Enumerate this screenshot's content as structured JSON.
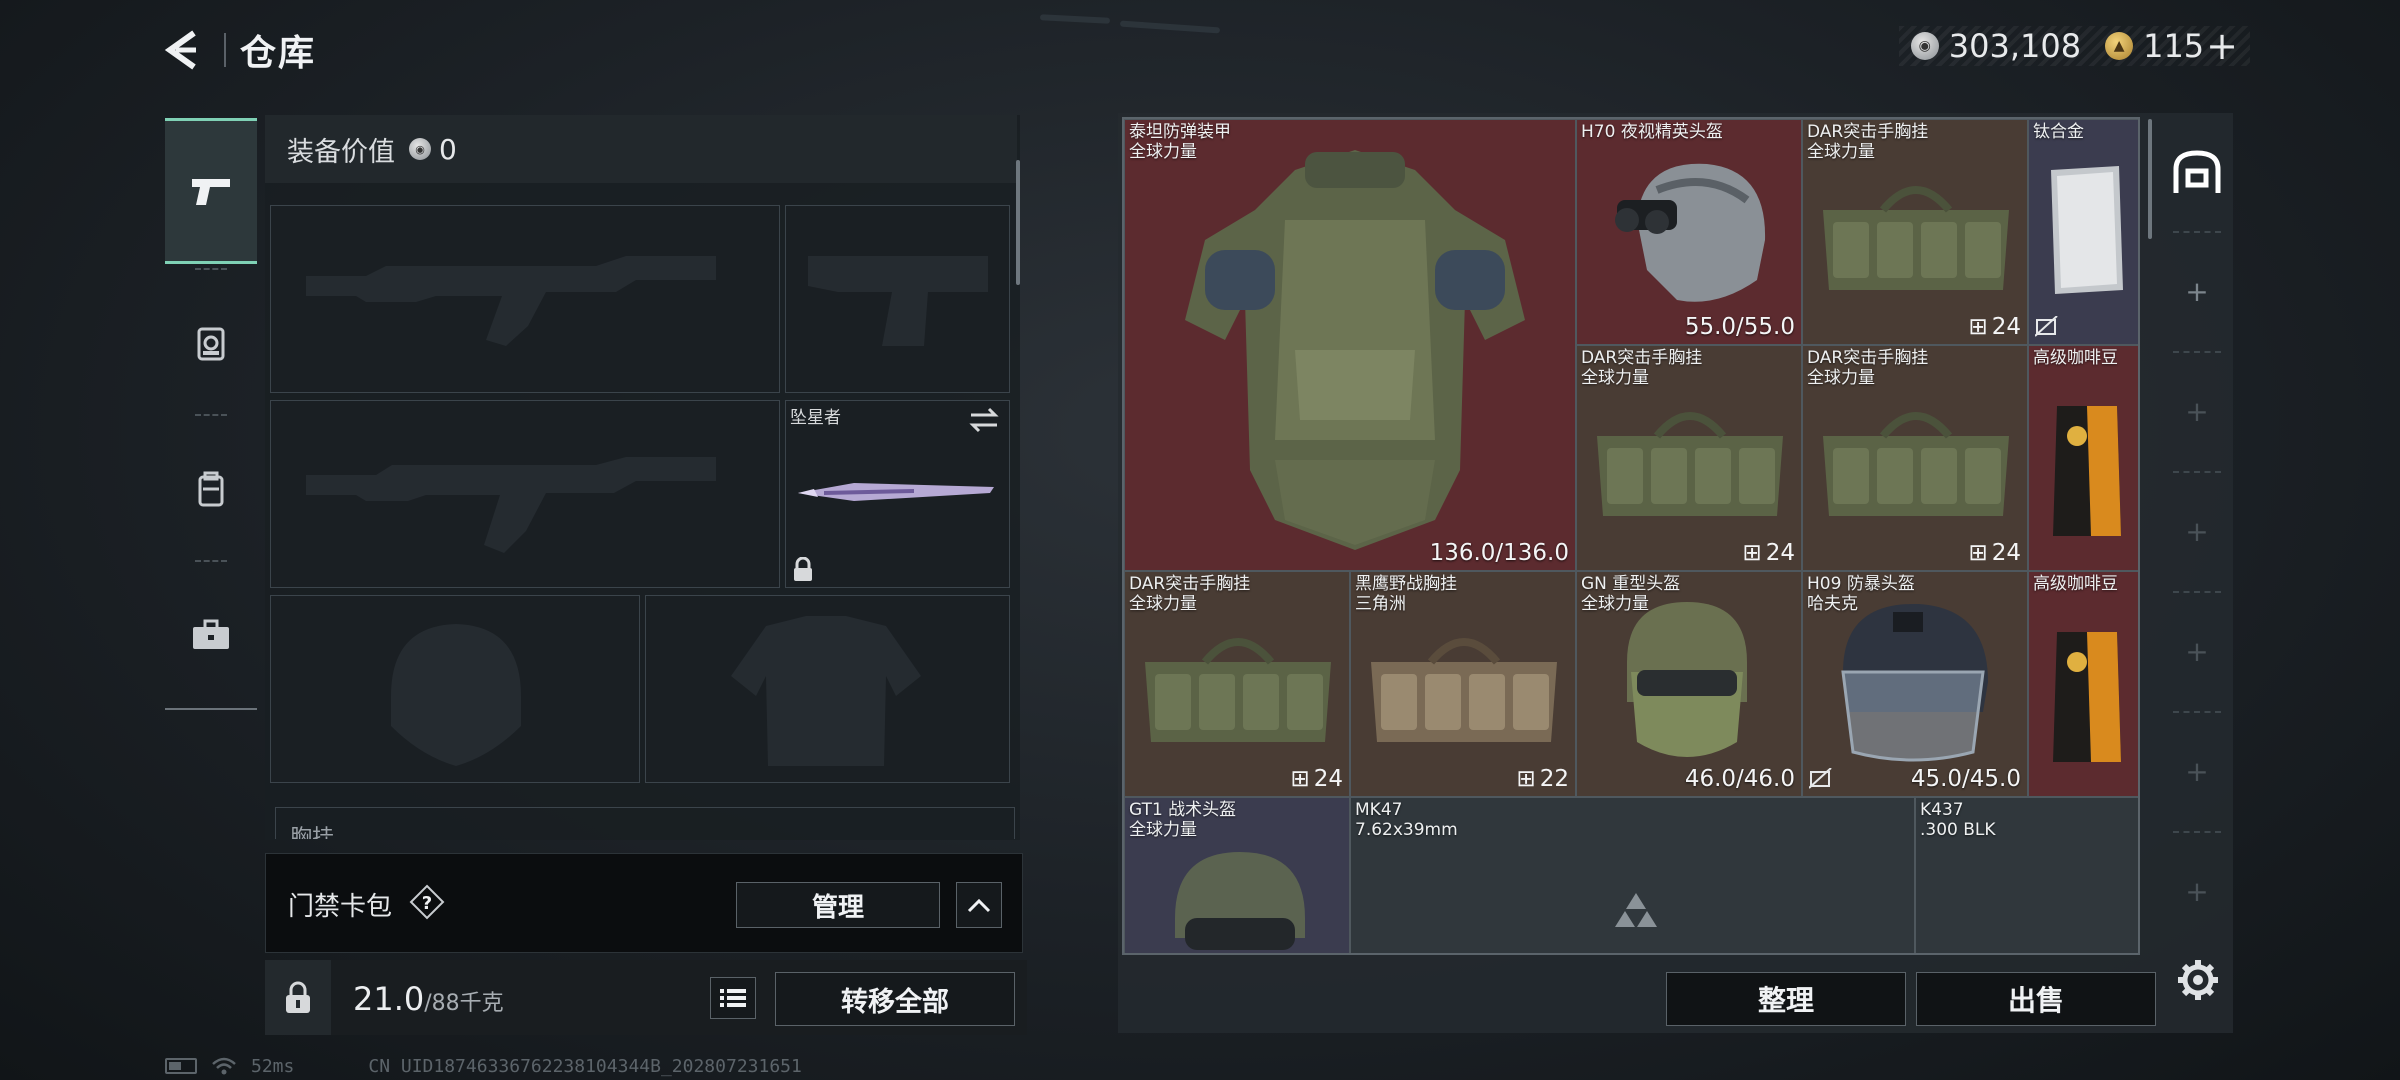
{
  "header": {
    "title": "仓库",
    "currency_silver": "303,108",
    "currency_gold": "115"
  },
  "equipment": {
    "value_label": "装备价值",
    "value": "0",
    "melee_name": "坠星者",
    "chest_label": "胸挂"
  },
  "card_pack": {
    "label": "门禁卡包",
    "manage_label": "管理"
  },
  "bag": {
    "weight": "21.0",
    "weight_max": "/88千克",
    "transfer_label": "转移全部"
  },
  "status_bar": {
    "ping": "52ms",
    "uid": "CN UID18746336762238104344B_202807231651"
  },
  "storage": {
    "items": [
      {
        "name": "泰坦防弹装甲",
        "sub": "全球力量",
        "value": "136.0/136.0"
      },
      {
        "name": "H70 夜视精英头盔",
        "sub": "",
        "value": "55.0/55.0"
      },
      {
        "name": "DAR突击手胸挂",
        "sub": "全球力量",
        "count": "24"
      },
      {
        "name": "钛合金",
        "sub": ""
      },
      {
        "name": "DAR突击手胸挂",
        "sub": "全球力量",
        "count": "24"
      },
      {
        "name": "DAR突击手胸挂",
        "sub": "全球力量",
        "count": "24"
      },
      {
        "name": "高级咖啡豆",
        "sub": ""
      },
      {
        "name": "DAR突击手胸挂",
        "sub": "全球力量",
        "count": "24"
      },
      {
        "name": "黑鹰野战胸挂",
        "sub": "三角洲",
        "count": "22"
      },
      {
        "name": "GN 重型头盔",
        "sub": "全球力量",
        "value": "46.0/46.0"
      },
      {
        "name": "H09 防暴头盔",
        "sub": "哈夫克",
        "value": "45.0/45.0"
      },
      {
        "name": "高级咖啡豆",
        "sub": ""
      },
      {
        "name": "GT1 战术头盔",
        "sub": "全球力量"
      },
      {
        "name": "MK47",
        "sub": "7.62x39mm"
      },
      {
        "name": "K437",
        "sub": ".300 BLK"
      }
    ],
    "sort_label": "整理",
    "sell_label": "出售"
  }
}
